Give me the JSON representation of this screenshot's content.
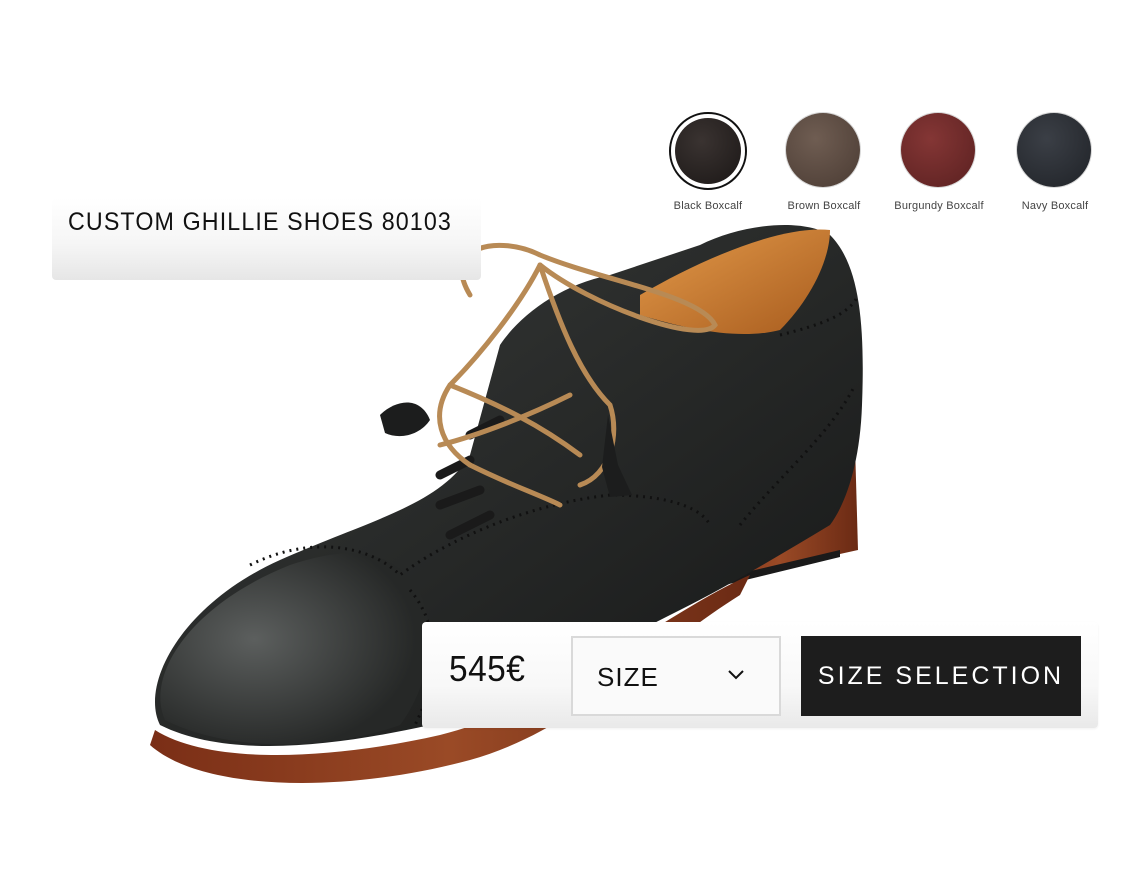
{
  "product": {
    "title": "CUSTOM GHILLIE SHOES 80103"
  },
  "colors": [
    {
      "label": "Black Boxcalf",
      "color": "#211d1b",
      "selected": true
    },
    {
      "label": "Brown Boxcalf",
      "color": "#5a4a40",
      "selected": false
    },
    {
      "label": "Burgundy Boxcalf",
      "color": "#6e2a29",
      "selected": false
    },
    {
      "label": "Navy Boxcalf",
      "color": "#2a2d33",
      "selected": false
    }
  ],
  "purchase": {
    "price": "545€",
    "size_placeholder": "SIZE",
    "size_button_label": "SIZE SELECTION"
  },
  "theme": {
    "leather": "#2b2d2c",
    "lining": "#c97a2c",
    "lace": "#b88a55",
    "sole": "#8a3a1e",
    "button": "#1d1d1d"
  }
}
